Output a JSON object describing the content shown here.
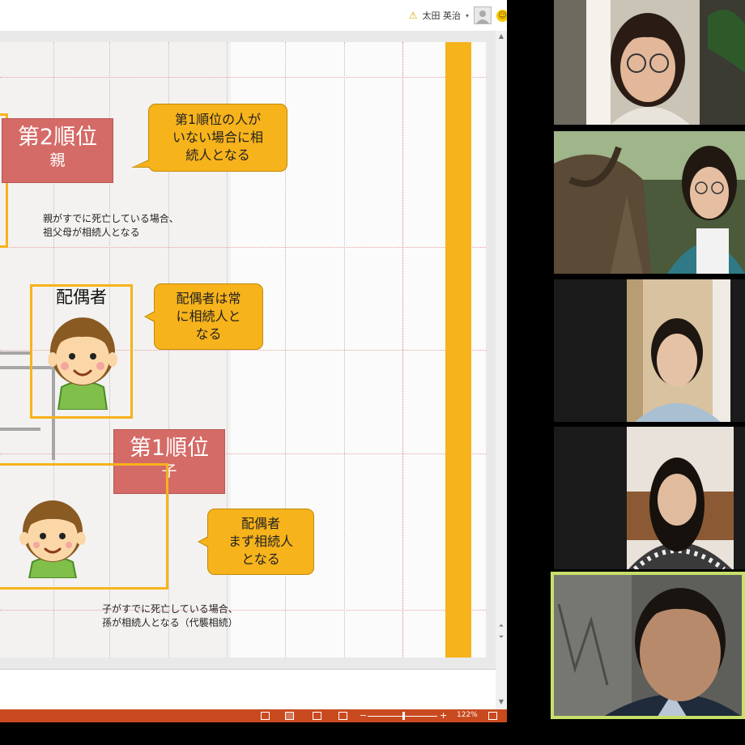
{
  "app": {
    "user_name": "太田 英治",
    "zoom_percent": "122%"
  },
  "slide": {
    "rank2": {
      "title": "第2順位",
      "sub": "親"
    },
    "rank1": {
      "title": "第1順位",
      "sub": "子"
    },
    "bubble_rank2": [
      "第1順位の人が",
      "いない場合に相",
      "続人となる"
    ],
    "bubble_spouse": [
      "配偶者は常",
      "に相続人と",
      "なる"
    ],
    "bubble_child": [
      "配偶者",
      "まず相続人",
      "となる"
    ],
    "note_parent": [
      "親がすでに死亡している場合、",
      "祖父母が相続人となる"
    ],
    "note_child": [
      "子がすでに死亡している場合、",
      "孫が相続人となる（代襲相続）"
    ],
    "spouse_label": "配偶者"
  },
  "colors": {
    "accent_orange": "#f7b31b",
    "rank_red": "#d46b67",
    "status_bar": "#c94a1f",
    "active_speaker": "#c7e06a"
  },
  "icons": [
    "warning-icon",
    "user-avatar-icon",
    "smiley-icon",
    "normal-view-icon",
    "slide-sorter-icon",
    "reading-view-icon",
    "slideshow-icon",
    "fit-slide-icon"
  ]
}
